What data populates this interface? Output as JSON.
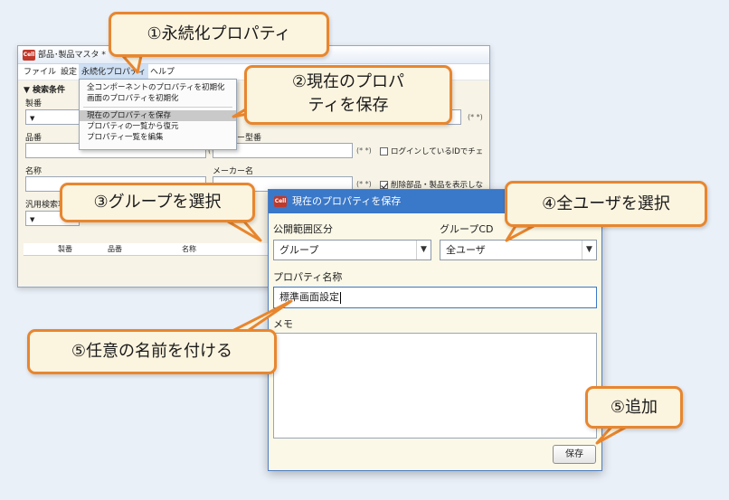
{
  "main_window": {
    "title": "部品･製品マスタ *",
    "menu": [
      "ファイル",
      "設定",
      "永続化プロパティ",
      "ヘルプ"
    ],
    "search_section": "▼ 検索条件",
    "labels": {
      "seiban": "製番",
      "hinban": "品番",
      "maker_part": "メーカー型番",
      "name": "名称",
      "maker_name": "メーカー名",
      "general_search": "汎用検索項"
    },
    "required_mark": "(* *)",
    "checkbox_login": "ログインしているIDでチェ",
    "checkbox_deleted": "削除部品・製品を表示しな",
    "grid_columns": [
      "製番",
      "品番",
      "名称"
    ]
  },
  "menu_popup": {
    "items": [
      "全コンポーネントのプロパティを初期化",
      "画面のプロパティを初期化",
      "現在のプロパティを保存",
      "プロパティの一覧から復元",
      "プロパティ一覧を編集"
    ],
    "highlighted_index": 2
  },
  "dialog": {
    "title": "現在のプロパティを保存",
    "scope_label": "公開範囲区分",
    "scope_value": "グループ",
    "group_label": "グループCD",
    "group_value": "全ユーザ",
    "name_label": "プロパティ名称",
    "name_value": "標準画面設定",
    "memo_label": "メモ",
    "save_button": "保存"
  },
  "app_icon_text": "Cell",
  "callouts": {
    "c1": "①永続化プロパティ",
    "c2_line1": "②現在のプロパ",
    "c2_line2": "ティを保存",
    "c3": "③グループを選択",
    "c4": "④全ユーザを選択",
    "c5": "⑤任意の名前を付ける",
    "c6": "⑤追加"
  },
  "colors": {
    "accent": "#e8862e",
    "callout_fill": "#fbf4df",
    "dialog_title": "#3a78c9",
    "form_background": "#fbf8e7"
  }
}
